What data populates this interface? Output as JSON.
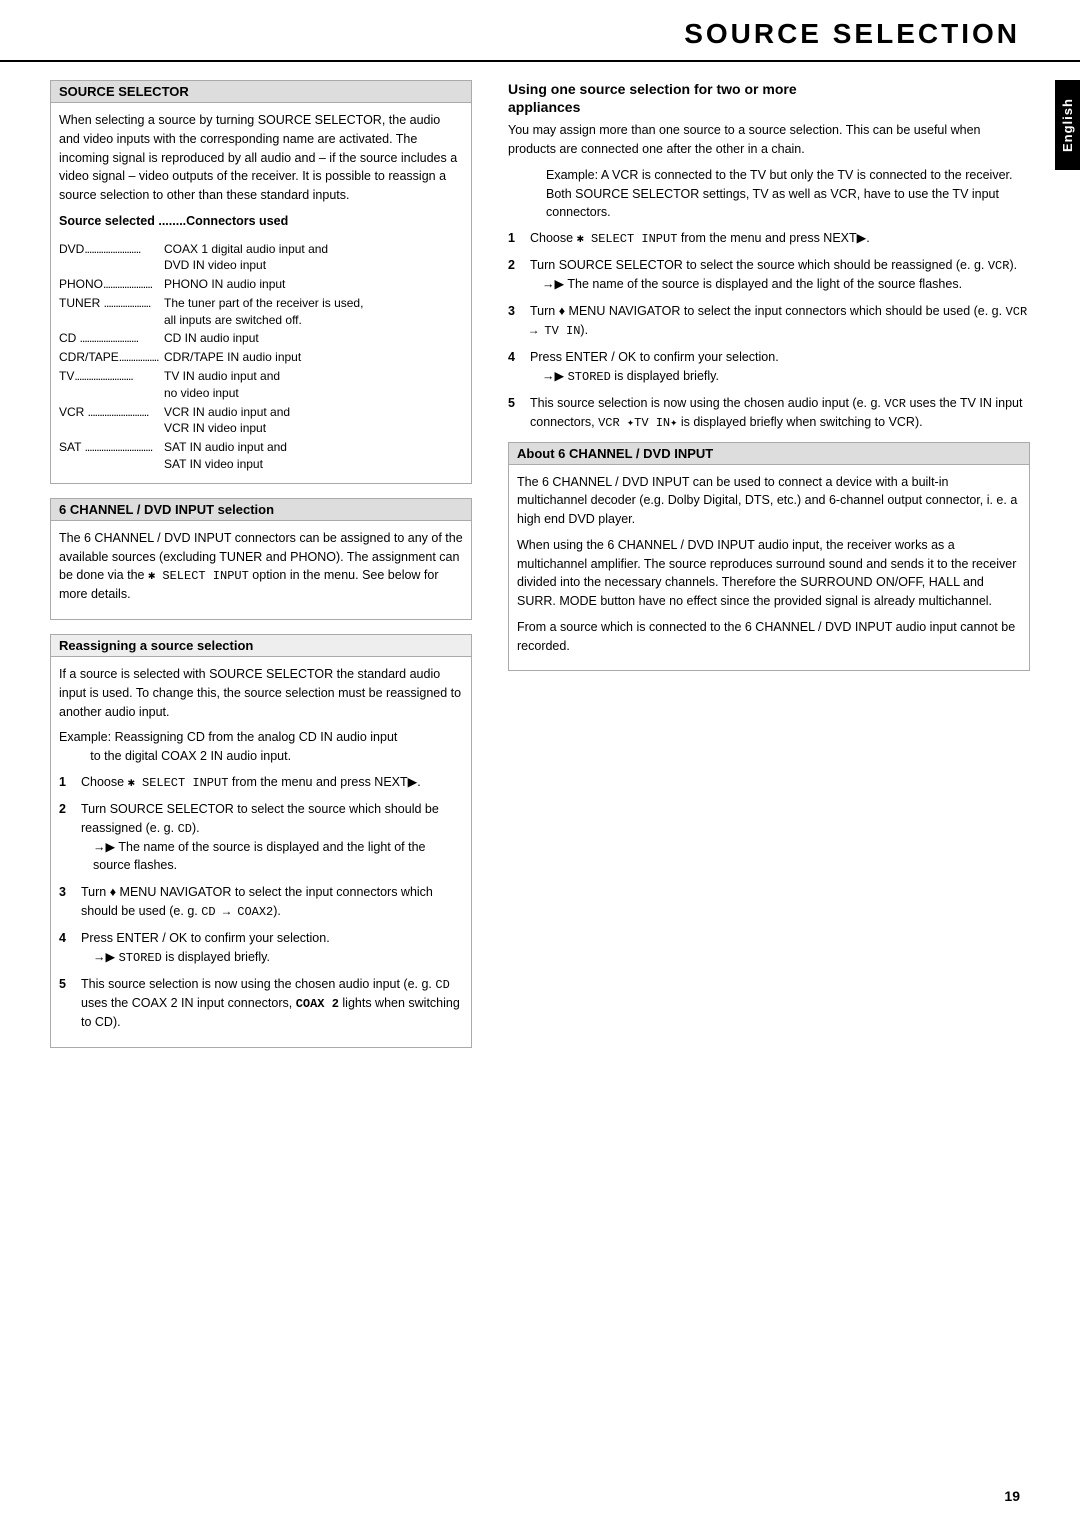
{
  "page": {
    "title": "SOURCE SELECTION",
    "page_number": "19",
    "english_tab": "English"
  },
  "source_selector": {
    "box_title": "SOURCE SELECTOR",
    "body": "When selecting a source by turning SOURCE SELECTOR, the audio and video inputs with the corresponding name are activated. The incoming signal is reproduced by all audio and – if the source includes a video signal – video outputs of the receiver. It is possible to reassign a source selection to other than these standard inputs.",
    "connectors_label": "Source selected ........Connectors used",
    "connectors": [
      {
        "source": "DVD",
        "dots": "......................",
        "connector1": "COAX 1 digital audio input and",
        "connector2": "DVD IN video input"
      },
      {
        "source": "PHONO",
        "dots": ".........................",
        "connector1": "PHONO IN audio input",
        "connector2": ""
      },
      {
        "source": "TUNER",
        "dots": " .....................",
        "connector1": "The tuner part of the receiver is used,",
        "connector2": "all inputs are switched off."
      },
      {
        "source": "CD",
        "dots": " .................................",
        "connector1": "CD IN audio input",
        "connector2": ""
      },
      {
        "source": "CDR/TAPE",
        "dots": "...................",
        "connector1": "CDR/TAPE IN audio input",
        "connector2": ""
      },
      {
        "source": "TV",
        "dots": ".................................",
        "connector1": "TV IN audio input and",
        "connector2": "no video input"
      },
      {
        "source": "VCR",
        "dots": " ..............................",
        "connector1": "VCR IN audio input and",
        "connector2": "VCR IN video input"
      },
      {
        "source": "SAT",
        "dots": " ...............................",
        "connector1": "SAT IN audio input and",
        "connector2": "SAT IN video input"
      }
    ]
  },
  "dvd_input_selection": {
    "box_title": "6 CHANNEL / DVD INPUT selection",
    "body": "The 6 CHANNEL / DVD INPUT connectors can be assigned to any of the available sources (excluding TUNER and PHONO). The assignment can be done via the",
    "mono_text": "✱ SELECT INPUT",
    "body2": "option in the menu. See below for more details.",
    "reassign": {
      "title": "Reassigning a source selection",
      "body": "If a source is selected with SOURCE SELECTOR the standard audio input is used. To change this, the source selection must be reassigned to another audio input.",
      "example": "Example: Reassigning CD from the analog CD IN audio input to the digital COAX 2 IN audio input.",
      "steps": [
        {
          "num": "1",
          "text": "Choose",
          "mono": "✱ SELECT INPUT",
          "text2": "from the menu and press NEXT",
          "arrow": "▶",
          "note": ""
        },
        {
          "num": "2",
          "text": "Turn SOURCE SELECTOR to select the source which should be reassigned (e. g. CD).",
          "note": "→▶ The name of the source is displayed and the light of the source flashes."
        },
        {
          "num": "3",
          "text": "Turn ♦ MENU NAVIGATOR to select the input connectors which should be used (e. g. CD → COAX2).",
          "note": ""
        },
        {
          "num": "4",
          "text": "Press ENTER / OK to confirm your selection.",
          "note": "→▶ STORED is displayed briefly."
        },
        {
          "num": "5",
          "text": "This source selection is now using the chosen audio input (e. g. CD uses the COAX 2 IN input connectors,",
          "mono2": "COAX 2",
          "text3": "lights when switching to CD)."
        }
      ]
    }
  },
  "using_one_source": {
    "heading_line1": "Using one source selection for two or more",
    "heading_line2": "appliances",
    "body1": "You may assign more than one source to a source selection. This can be useful when products are connected one after the other in a chain.",
    "example": "Example: A VCR is connected to the TV but only the TV is connected to the receiver. Both SOURCE SELECTOR settings, TV as well as VCR, have to use the TV input connectors.",
    "steps": [
      {
        "num": "1",
        "text": "Choose",
        "mono": "✱ SELECT INPUT",
        "text2": "from the menu and press NEXT",
        "arrow": "▶",
        "note": ""
      },
      {
        "num": "2",
        "text": "Turn SOURCE SELECTOR to select the source which should be reassigned (e. g. VCR).",
        "note": "→▶ The name of the source is displayed and the light of the source flashes."
      },
      {
        "num": "3",
        "text": "Turn ♦ MENU NAVIGATOR to select the input connectors which should be used (e. g. VCR → TV IN).",
        "note": ""
      },
      {
        "num": "4",
        "text": "Press ENTER / OK to confirm your selection.",
        "note": "→▶ STORED is displayed briefly."
      },
      {
        "num": "5",
        "text": "This source selection is now using the chosen audio input (e. g. VCR uses the TV IN input connectors, VCR ✦TV IN✦ is displayed briefly when switching to VCR).",
        "note": ""
      }
    ]
  },
  "about_6channel": {
    "box_title": "About 6 CHANNEL / DVD INPUT",
    "body1": "The 6 CHANNEL / DVD INPUT can be used to connect a device with a built-in multichannel decoder (e.g. Dolby Digital, DTS, etc.) and 6-channel output connector, i. e. a high end DVD player.",
    "body2": "When using the 6 CHANNEL / DVD INPUT audio input, the receiver works as a multichannel amplifier. The source reproduces surround sound and sends it to the receiver divided into the necessary channels. Therefore the SURROUND ON/OFF, HALL and SURR. MODE button have no effect since the provided signal is already multichannel.",
    "body3": "From a source which is connected to the 6 CHANNEL / DVD INPUT audio input cannot be recorded."
  }
}
